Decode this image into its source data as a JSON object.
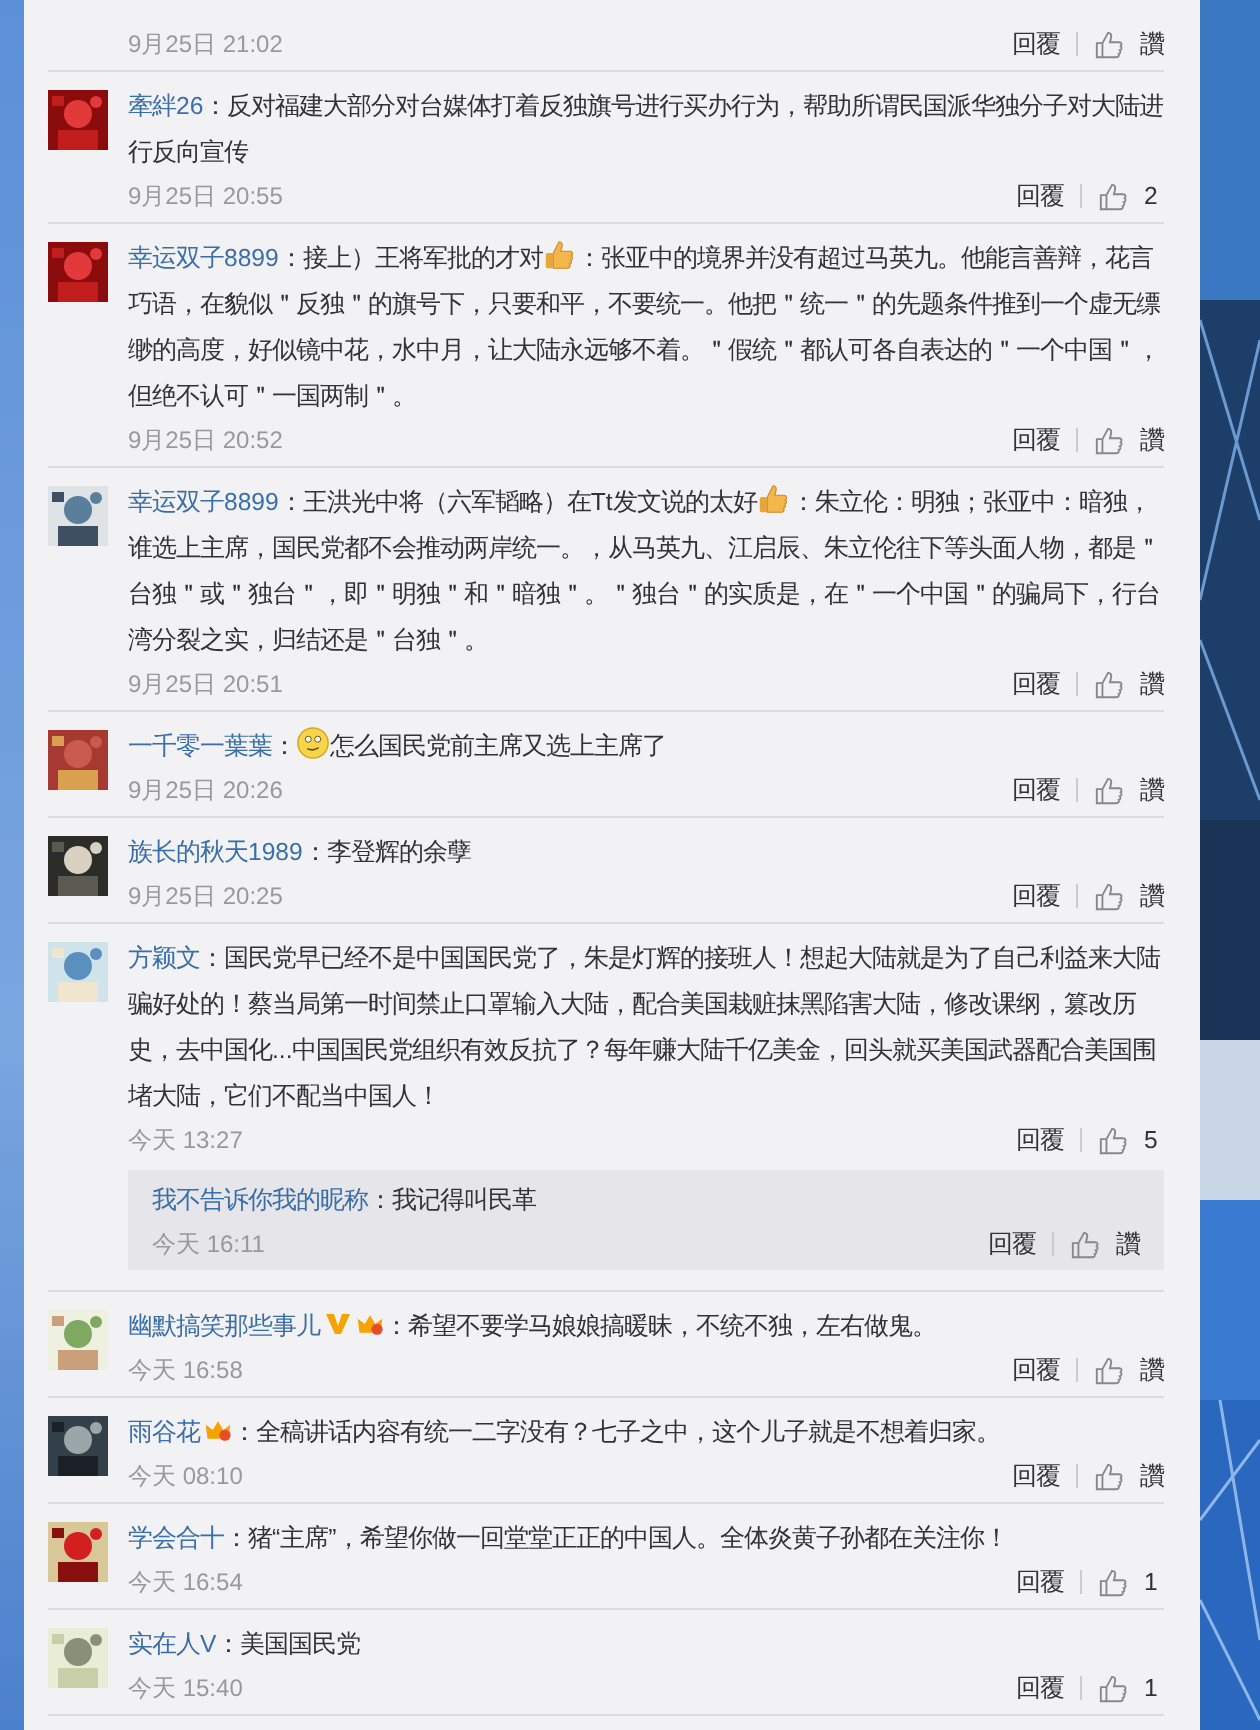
{
  "comments": [
    {
      "kind": "partial",
      "time": "9月25日 21:02",
      "reply": "回覆",
      "likes": "讚"
    },
    {
      "kind": "comment",
      "avatar": {
        "kind": "picture"
      },
      "user": "牽絆26",
      "body": [
        {
          "kind": "text",
          "text": "：反对福建大部分对台媒体打着反独旗号进行买办行为，帮助所谓民国派华独分子对大陆进行反向宣传"
        }
      ],
      "time": "9月25日 20:55",
      "reply": "回覆",
      "likes": "2"
    },
    {
      "kind": "comment",
      "avatar": {
        "kind": "picture"
      },
      "user": "幸运双子8899",
      "body": [
        {
          "kind": "text",
          "text": "：接上）王将军批的才对"
        },
        {
          "kind": "thumbs"
        },
        {
          "kind": "text",
          "text": "：张亚中的境界并没有超过马英九。他能言善辩，花言巧语，在貌似＂反独＂的旗号下，只要和平，不要统一。他把＂统一＂的先题条件推到一个虚无缥缈的高度，好似镜中花，水中月，让大陆永远够不着。＂假统＂都认可各自表达的＂一个中国＂，但绝不认可＂一国两制＂。"
        }
      ],
      "time": "9月25日 20:52",
      "reply": "回覆",
      "likes": "讚"
    },
    {
      "kind": "comment",
      "avatar": {
        "kind": "picture"
      },
      "user": "幸运双子8899",
      "body": [
        {
          "kind": "text",
          "text": "：王洪光中将（六军韬略）在Tt发文说的太好"
        },
        {
          "kind": "thumbs"
        },
        {
          "kind": "text",
          "text": "：朱立伦：明独；张亚中：暗独，谁选上主席，国民党都不会推动两岸统一。，从马英九、江启辰、朱立伦往下等头面人物，都是＂台独＂或＂独台＂，即＂明独＂和＂暗独＂。＂独台＂的实质是，在＂一个中国＂的骗局下，行台湾分裂之实，归结还是＂台独＂。"
        }
      ],
      "time": "9月25日 20:51",
      "reply": "回覆",
      "likes": "讚"
    },
    {
      "kind": "comment",
      "avatar": {
        "kind": "picture"
      },
      "user": "一千零一葉葉",
      "body": [
        {
          "kind": "text",
          "text": "："
        },
        {
          "kind": "smile"
        },
        {
          "kind": "text",
          "text": "怎么国民党前主席又选上主席了"
        }
      ],
      "time": "9月25日 20:26",
      "reply": "回覆",
      "likes": "讚"
    },
    {
      "kind": "comment",
      "avatar": {
        "kind": "picture"
      },
      "user": "族长的秋天1989",
      "body": [
        {
          "kind": "text",
          "text": "：李登辉的余孽"
        }
      ],
      "time": "9月25日 20:25",
      "reply": "回覆",
      "likes": "讚"
    },
    {
      "kind": "comment",
      "avatar": {
        "kind": "picture"
      },
      "user": "方颖文",
      "body": [
        {
          "kind": "text",
          "text": "：国民党早已经不是中国国民党了，朱是灯辉的接班人！想起大陆就是为了自己利益来大陆骗好处的！蔡当局第一时间禁止口罩输入大陆，配合美国栽赃抹黑陷害大陆，修改课纲，篡改历史，去中国化...中国国民党组织有效反抗了？每年赚大陆千亿美金，回头就买美国武器配合美国围堵大陆，它们不配当中国人！"
        }
      ],
      "time": "今天 13:27",
      "reply": "回覆",
      "likes": "5",
      "replies": [
        {
          "user": "我不告诉你我的昵称",
          "text": "：我记得叫民革",
          "time": "今天 16:11",
          "reply": "回覆",
          "likes": "讚"
        }
      ]
    },
    {
      "kind": "comment",
      "avatar": {
        "kind": "picture"
      },
      "user": "幽默搞笑那些事儿",
      "badges": [
        {
          "kind": "verified"
        },
        {
          "kind": "crown"
        }
      ],
      "body": [
        {
          "kind": "text",
          "text": "：希望不要学马娘娘搞暖昧，不统不独，左右做鬼。"
        }
      ],
      "time": "今天 16:58",
      "reply": "回覆",
      "likes": "讚"
    },
    {
      "kind": "comment",
      "avatar": {
        "kind": "picture"
      },
      "user": "雨谷花",
      "badges": [
        {
          "kind": "crown"
        }
      ],
      "body": [
        {
          "kind": "text",
          "text": "：全稿讲话内容有统一二字没有？七子之中，这个儿子就是不想着归家。"
        }
      ],
      "time": "今天 08:10",
      "reply": "回覆",
      "likes": "讚"
    },
    {
      "kind": "comment",
      "avatar": {
        "kind": "picture"
      },
      "user": "学会合十",
      "body": [
        {
          "kind": "text",
          "text": "：猪“主席”，希望你做一回堂堂正正的中国人。全体炎黄子孙都在关注你！"
        }
      ],
      "time": "今天 16:54",
      "reply": "回覆",
      "likes": "1"
    },
    {
      "kind": "comment",
      "avatar": {
        "kind": "picture"
      },
      "user": "实在人V",
      "body": [
        {
          "kind": "text",
          "text": "：美国国民党"
        }
      ],
      "time": "今天 15:40",
      "reply": "回覆",
      "likes": "1"
    }
  ]
}
